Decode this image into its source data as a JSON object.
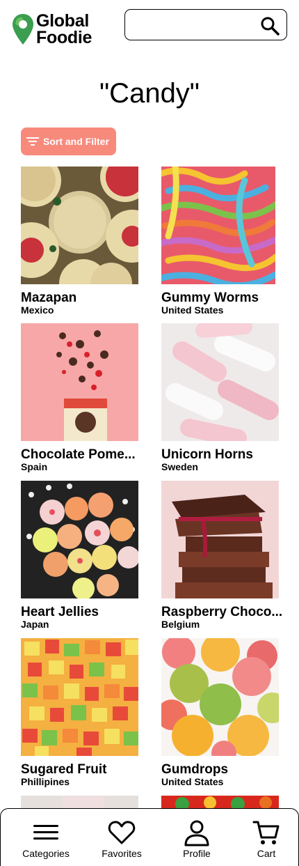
{
  "header": {
    "logo_line1": "Global",
    "logo_line2": "Foodie",
    "search_placeholder": ""
  },
  "page": {
    "title": "\"Candy\"",
    "sort_filter_label": "Sort and Filter"
  },
  "products": [
    {
      "name": "Mazapan",
      "country": "Mexico"
    },
    {
      "name": "Gummy Worms",
      "country": "United States"
    },
    {
      "name": "Chocolate Pome...",
      "country": "Spain"
    },
    {
      "name": "Unicorn Horns",
      "country": "Sweden"
    },
    {
      "name": "Heart Jellies",
      "country": "Japan"
    },
    {
      "name": "Raspberry Choco...",
      "country": "Belgium"
    },
    {
      "name": "Sugared Fruit",
      "country": "Phillipines"
    },
    {
      "name": "Gumdrops",
      "country": "United States"
    }
  ],
  "nav": {
    "categories": "Categories",
    "favorites": "Favorites",
    "profile": "Profile",
    "cart": "Cart"
  },
  "colors": {
    "accent": "#f88a7c",
    "logo_green": "#2e9a4a"
  }
}
